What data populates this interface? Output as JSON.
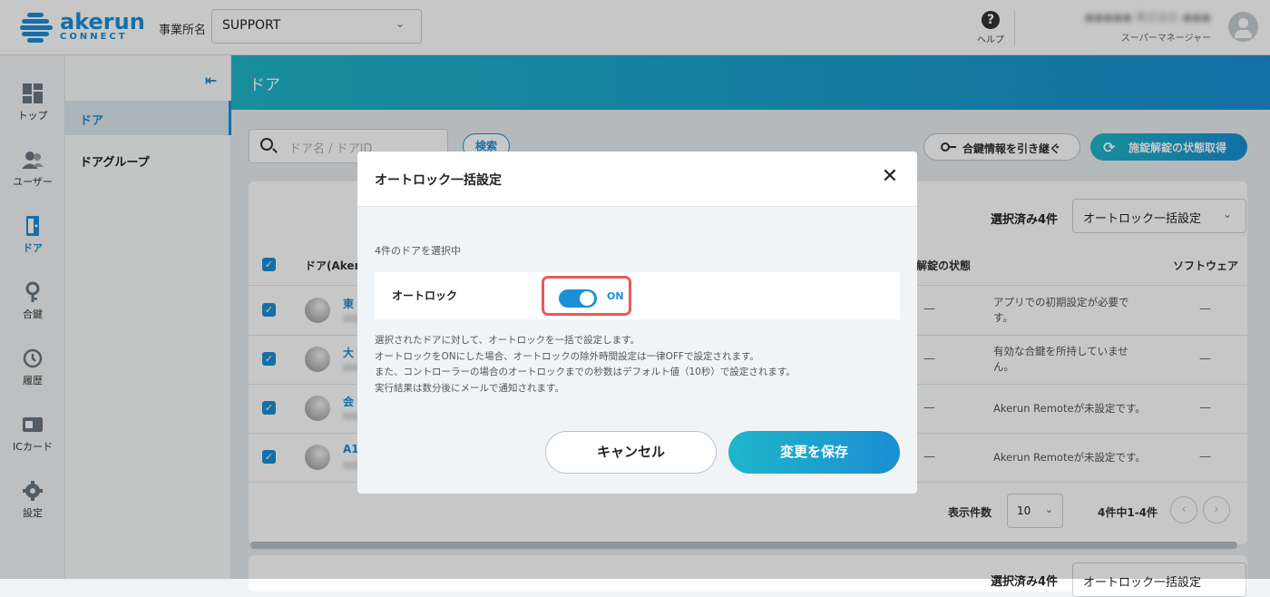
{
  "header": {
    "logo_word": "akerun",
    "logo_sub": "CONNECT",
    "office_label": "事業所名",
    "office_value": "SUPPORT",
    "help_label": "ヘルプ",
    "user_name": "●●●●● 株式会社 ●●●",
    "user_role": "スーパーマネージャー"
  },
  "nav": {
    "items": [
      {
        "label": "トップ",
        "icon": "dashboard-icon"
      },
      {
        "label": "ユーザー",
        "icon": "users-icon"
      },
      {
        "label": "ドア",
        "icon": "door-icon"
      },
      {
        "label": "合鍵",
        "icon": "key-icon"
      },
      {
        "label": "履歴",
        "icon": "history-icon"
      },
      {
        "label": "ICカード",
        "icon": "card-icon"
      },
      {
        "label": "設定",
        "icon": "gear-icon"
      }
    ]
  },
  "subnav": {
    "items": [
      "ドア",
      "ドアグループ"
    ]
  },
  "page": {
    "title": "ドア",
    "search_placeholder": "ドア名 / ドアID",
    "search_button": "検索",
    "key_inherit_button": "合鍵情報を引き継ぐ",
    "status_button": "施錠解錠の状態取得",
    "selected_count": "選択済み4件",
    "bulk_action": "オートロック一括設定"
  },
  "table": {
    "headers": {
      "door": "ドア(Akeru",
      "lock_state": "解錠の状態",
      "software": "ソフトウェア"
    },
    "rows": [
      {
        "name": "東",
        "lock": "—",
        "message": "アプリでの初期設定が必要です。",
        "software": "—"
      },
      {
        "name": "大",
        "lock": "—",
        "message": "有効な合鍵を所持していません。",
        "software": "—"
      },
      {
        "name": "会",
        "lock": "—",
        "message": "Akerun Remoteが未設定です。",
        "software": "—"
      },
      {
        "name": "A1",
        "lock": "—",
        "message": "Akerun Remoteが未設定です。",
        "software": "—"
      }
    ]
  },
  "pager": {
    "label": "表示件数",
    "per_page": "10",
    "info": "4件中1-4件",
    "prev": "‹",
    "next": "›"
  },
  "bottom": {
    "selected_count": "選択済み4件",
    "bulk_action": "オートロック一括設定"
  },
  "modal": {
    "title": "オートロック一括設定",
    "close": "✕",
    "selection": "4件のドアを選択中",
    "autolock_label": "オートロック",
    "toggle_state": "ON",
    "description": [
      "選択されたドアに対して、オートロックを一括で設定します。",
      "オートロックをONにした場合、オートロックの除外時間設定は一律OFFで設定されます。",
      "また、コントローラーの場合のオートロックまでの秒数はデフォルト値（10秒）で設定されます。",
      "実行結果は数分後にメールで通知されます。"
    ],
    "cancel": "キャンセル",
    "save": "変更を保存"
  },
  "colors": {
    "accent": "#1b8fd6",
    "gradient_start": "#1fb6c9",
    "gradient_end": "#1a8fd2",
    "highlight": "#e85a5a"
  }
}
